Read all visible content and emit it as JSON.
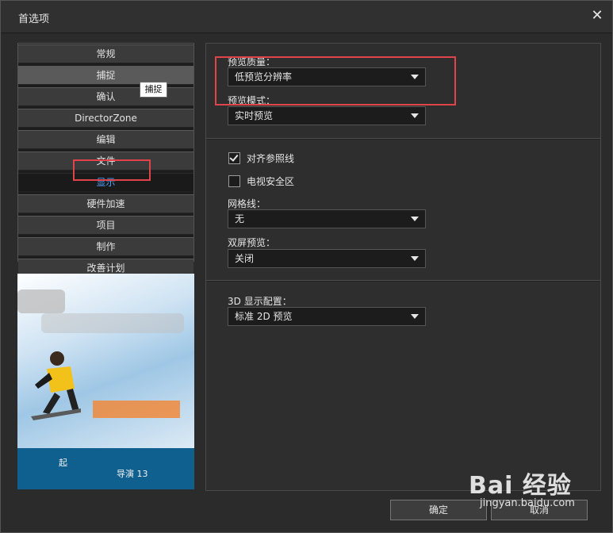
{
  "window": {
    "title": "首选项",
    "close_glyph": "✕"
  },
  "sidebar": {
    "items": [
      {
        "label": "常规"
      },
      {
        "label": "捕捉"
      },
      {
        "label": "确认"
      },
      {
        "label": "DirectorZone"
      },
      {
        "label": "编辑"
      },
      {
        "label": "文件"
      },
      {
        "label": "显示"
      },
      {
        "label": "硬件加速"
      },
      {
        "label": "项目"
      },
      {
        "label": "制作"
      },
      {
        "label": "改善计划"
      }
    ],
    "hovered": "捕捉",
    "active": "显示",
    "tooltip": "捕捉"
  },
  "preview_image": {
    "caption_top": "起",
    "caption_bottom": "导演 13"
  },
  "display": {
    "preview_quality": {
      "label": "预览质量：",
      "value": "低预览分辨率"
    },
    "preview_mode": {
      "label": "预览模式：",
      "value": "实时预览"
    },
    "reference_lines": {
      "label": "对齐参照线",
      "checked": true
    },
    "tv_safe_zone": {
      "label": "电视安全区",
      "checked": false
    },
    "gridlines": {
      "label": "网格线：",
      "value": "无"
    },
    "dual_preview": {
      "label": "双屏预览：",
      "value": "关闭"
    },
    "display_3d": {
      "label": "3D 显示配置：",
      "value": "标准 2D 预览"
    }
  },
  "buttons": {
    "ok": "确定",
    "cancel": "取消"
  },
  "watermark": {
    "brand": "Bai 经验",
    "url": "jingyan.baidu.com"
  },
  "colors": {
    "accent": "#4aa3ff",
    "highlight_box": "#e0434a"
  },
  "icons": [
    "close-icon",
    "dropdown-arrow-icon",
    "checkbox-icon"
  ]
}
